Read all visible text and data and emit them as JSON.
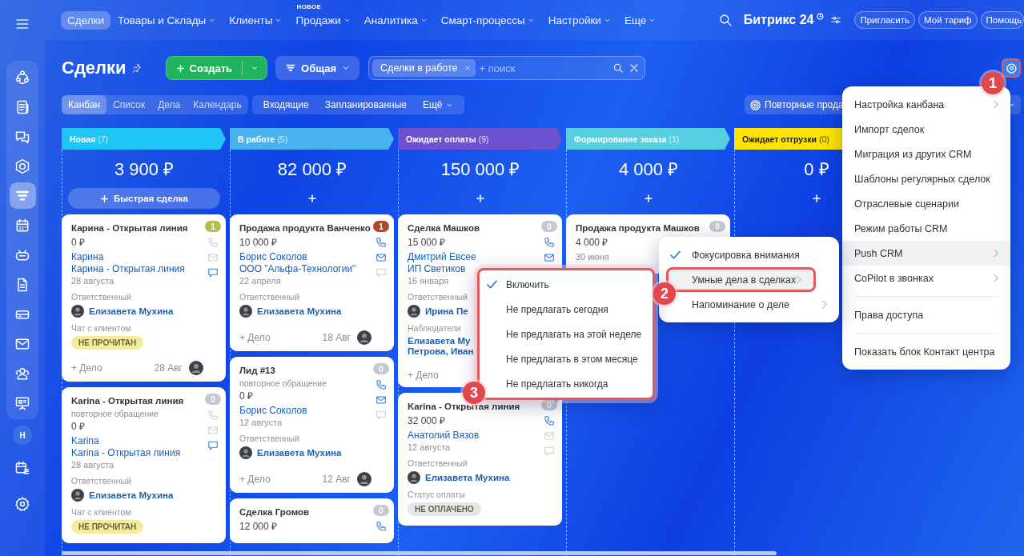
{
  "sidebar": {
    "items": [
      {
        "kind": "circles",
        "selected": false
      },
      {
        "kind": "news",
        "selected": false
      },
      {
        "kind": "chat",
        "selected": false
      },
      {
        "kind": "hexagon",
        "selected": false
      },
      {
        "kind": "funnel",
        "selected": true
      },
      {
        "kind": "calendar",
        "selected": false
      },
      {
        "kind": "robot",
        "selected": false
      },
      {
        "kind": "document",
        "selected": false
      },
      {
        "kind": "card",
        "selected": false
      },
      {
        "kind": "mail",
        "selected": false
      },
      {
        "kind": "contacts",
        "selected": false
      },
      {
        "kind": "presentation",
        "selected": false
      }
    ],
    "avatar": "Н"
  },
  "nav": {
    "items": [
      {
        "label": "Сделки",
        "selected": true,
        "dropdown": false
      },
      {
        "label": "Товары и Склады",
        "selected": false,
        "dropdown": true
      },
      {
        "label": "Клиенты",
        "selected": false,
        "dropdown": true
      },
      {
        "label": "Продажи",
        "selected": false,
        "dropdown": true,
        "badge": "НОВОЕ"
      },
      {
        "label": "Аналитика",
        "selected": false,
        "dropdown": true
      },
      {
        "label": "Смарт-процессы",
        "selected": false,
        "dropdown": true
      },
      {
        "label": "Настройки",
        "selected": false,
        "dropdown": true
      },
      {
        "label": "Еще",
        "selected": false,
        "dropdown": true
      }
    ],
    "brand": "Битрикс 24",
    "buttons": [
      "Пригласить",
      "Мой тариф",
      "Помощь"
    ]
  },
  "header": {
    "title": "Сделки",
    "create": "Создать",
    "category": "Общая",
    "search": {
      "tags": [
        "Сделки в работе"
      ],
      "placeholder": "+ поиск"
    },
    "settings_annotation": "1"
  },
  "views": [
    {
      "label": "Канбан",
      "selected": true
    },
    {
      "label": "Список",
      "selected": false
    },
    {
      "label": "Дела",
      "selected": false
    },
    {
      "label": "Календарь",
      "selected": false
    }
  ],
  "counters": [
    {
      "label": "Входящие",
      "dropdown": false
    },
    {
      "label": "Запланированные",
      "dropdown": false
    },
    {
      "label": "Ещё",
      "dropdown": true
    }
  ],
  "repeat_sales": "Повторные прода",
  "columns": [
    {
      "title": "Новая",
      "count": "(7)",
      "color": "#1ec6f5",
      "total": "3 900 ₽",
      "quick_add": "Быстрая сделка",
      "cards": [
        {
          "title": "Карина - Открытая линия",
          "amount": "0 ₽",
          "links": [
            "Карина",
            "Карина - Открытая линия"
          ],
          "date": "28 августа",
          "sections": [
            {
              "kind": "person",
              "label": "Ответственный",
              "value": "Елизавета Мухина"
            },
            {
              "kind": "badge",
              "label": "Чат с клиентом",
              "value": "НЕ ПРОЧИТАН",
              "color": "#f3ec9e"
            }
          ],
          "footer": {
            "add": "+ Дело",
            "date": "28 Авг",
            "avatar": true
          },
          "counter": {
            "value": "1",
            "color": "#b5bf45"
          },
          "contacts": [
            {
              "kind": "phone",
              "active": false
            },
            {
              "kind": "mail",
              "active": false
            },
            {
              "kind": "chat",
              "active": true
            }
          ]
        },
        {
          "title": "Karina - Открытая линия",
          "subtitle": "повторное обращение",
          "amount": "0 ₽",
          "links": [
            "Karina",
            "Karina - Открытая линия"
          ],
          "date": "28 августа",
          "sections": [
            {
              "kind": "person",
              "label": "Ответственный",
              "value": "Елизавета Мухина"
            },
            {
              "kind": "badge",
              "label": "Чат с клиентом",
              "value": "НЕ ПРОЧИТАН",
              "color": "#f3ec9e"
            }
          ],
          "counter": {
            "value": "0",
            "color": "#c3c9d1"
          },
          "contacts": [
            {
              "kind": "phone",
              "active": false
            },
            {
              "kind": "mail",
              "active": false
            },
            {
              "kind": "chat",
              "active": true
            }
          ]
        }
      ]
    },
    {
      "title": "В работе",
      "count": "(5)",
      "color": "#48b2ee",
      "total": "82 000 ₽",
      "cards": [
        {
          "title": "Продажа продукта Ванченко",
          "amount": "10 000 ₽",
          "links": [
            "Борис Соколов",
            "ООО \"Альфа-Технологии\""
          ],
          "date": "22 апреля",
          "sections": [
            {
              "kind": "person",
              "label": "Ответственный",
              "value": "Елизавета Мухина"
            }
          ],
          "footer": {
            "add": "+ Дело",
            "date": "18 Авг",
            "avatar": true
          },
          "counter": {
            "value": "1",
            "color": "#b4452c"
          },
          "contacts": [
            {
              "kind": "phone",
              "active": true
            },
            {
              "kind": "mail",
              "active": true
            },
            {
              "kind": "chat",
              "active": false
            }
          ]
        },
        {
          "title": "Лид #13",
          "subtitle": "повторное обращение",
          "amount": "0 ₽",
          "links": [
            "Борис Соколов"
          ],
          "date": "12 августа",
          "sections": [
            {
              "kind": "person",
              "label": "Ответственный",
              "value": "Елизавета Мухина"
            }
          ],
          "footer": {
            "add": "+ Дело",
            "date": "12 Авг",
            "avatar": true
          },
          "counter": {
            "value": "0",
            "color": "#c3c9d1"
          },
          "contacts": [
            {
              "kind": "phone",
              "active": true
            },
            {
              "kind": "mail",
              "active": true
            },
            {
              "kind": "chat",
              "active": false
            }
          ]
        },
        {
          "title": "Сделка Громов",
          "amount": "12 000 ₽",
          "counter": {
            "value": "0",
            "color": "#c3c9d1"
          },
          "contacts": [
            {
              "kind": "phone",
              "active": true
            }
          ]
        }
      ]
    },
    {
      "title": "Ожидает оплаты",
      "count": "(9)",
      "color": "#6d52cf",
      "total": "150 000 ₽",
      "cards": [
        {
          "title": "Сделка Машков",
          "amount": "15 000 ₽",
          "links": [
            "Дмитрий Евсее",
            "ИП Светиков"
          ],
          "date": "16 января",
          "sections": [
            {
              "kind": "person",
              "label": "Ответственный",
              "value": "Ирина Пе"
            },
            {
              "kind": "links",
              "label": "Наблюдатели",
              "values": [
                "Елизавета Му",
                "Петрова, Иван"
              ]
            }
          ],
          "footer": {
            "add": "+ Дело"
          },
          "counter": {
            "value": "0",
            "color": "#c3c9d1"
          },
          "contacts": [
            {
              "kind": "phone",
              "active": true
            },
            {
              "kind": "mail",
              "active": true
            }
          ]
        },
        {
          "title": "Karina - Открытая линия",
          "amount": "32 000 ₽",
          "links": [
            "Анатолий Вязов"
          ],
          "date": "12 августа",
          "sections": [
            {
              "kind": "person",
              "label": "Ответственный",
              "value": "Елизавета Мухина"
            },
            {
              "kind": "badge",
              "label": "Статус оплаты",
              "value": "НЕ ОПЛАЧЕНО",
              "color": "#e3e6ea"
            }
          ],
          "counter": {
            "value": "0",
            "color": "#c3c9d1",
            "dot": true
          },
          "contacts": [
            {
              "kind": "phone",
              "active": true
            },
            {
              "kind": "mail",
              "active": false
            },
            {
              "kind": "chat",
              "active": false
            }
          ]
        }
      ]
    },
    {
      "title": "Формирование заказа",
      "count": "(1)",
      "color": "#56cfe0",
      "total": "4 000 ₽",
      "cards": [
        {
          "title": "Продажа продукта Машков",
          "amount": "4 000 ₽",
          "date": "30 июня",
          "counter": {
            "value": "0",
            "color": "#c3c9d1"
          }
        }
      ]
    },
    {
      "title": "Ожидает отгрузки",
      "count": "(0)",
      "color": "#ffe400",
      "total": "0 ₽"
    }
  ],
  "settings_menu": {
    "items": [
      {
        "label": "Настройка канбана",
        "submenu": true,
        "highlighted": false
      },
      {
        "label": "Импорт сделок",
        "submenu": false,
        "highlighted": false
      },
      {
        "label": "Миграция из других CRM",
        "submenu": false,
        "highlighted": false
      },
      {
        "label": "Шаблоны регулярных сделок",
        "submenu": false,
        "highlighted": false
      },
      {
        "label": "Отраслевые сценарии",
        "submenu": false,
        "highlighted": false
      },
      {
        "label": "Режим работы CRM",
        "submenu": false,
        "highlighted": false
      },
      {
        "label": "Push CRM",
        "submenu": true,
        "highlighted": true
      },
      {
        "label": "CoPilot в звонках",
        "submenu": true,
        "highlighted": false
      },
      {
        "label": "Права доступа",
        "submenu": false,
        "highlighted": false,
        "divider_before": true
      },
      {
        "label": "Показать блок Контакт центра",
        "submenu": false,
        "highlighted": false,
        "divider_before": true
      }
    ]
  },
  "push_menu": {
    "items": [
      {
        "label": "Фокусировка внимания",
        "checked": true,
        "submenu": false,
        "highlighted": false
      },
      {
        "label": "Умные дела в сделках",
        "checked": false,
        "submenu": true,
        "highlighted": true,
        "annotation": "2"
      },
      {
        "label": "Напоминание о деле",
        "checked": false,
        "submenu": true,
        "highlighted": false
      }
    ]
  },
  "smart_menu": {
    "annotation": "3",
    "items": [
      {
        "label": "Включить",
        "checked": true
      },
      {
        "label": "Не предлагать сегодня",
        "checked": false
      },
      {
        "label": "Не предлагать на этой неделе",
        "checked": false
      },
      {
        "label": "Не предлагать в этом месяце",
        "checked": false
      },
      {
        "label": "Не предлагать никогда",
        "checked": false
      }
    ]
  }
}
